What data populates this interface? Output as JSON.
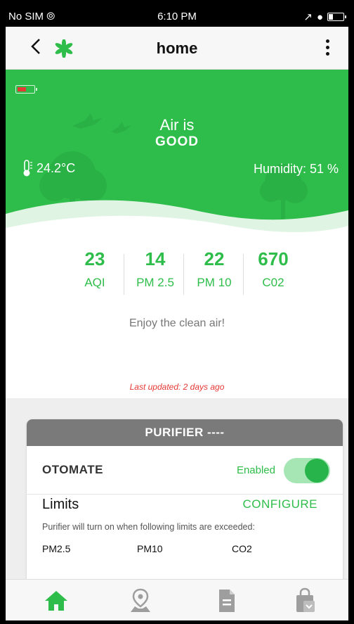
{
  "status_bar": {
    "carrier": "No SIM",
    "time": "6:10 PM"
  },
  "app_bar": {
    "title": "home"
  },
  "hero": {
    "air_line1": "Air is",
    "air_status": "GOOD",
    "temperature": "24.2°C",
    "humidity": "Humidity: 51 %",
    "device_battery_level": 0.4,
    "colors": {
      "green": "#2ebd4a",
      "battery_low": "#e53935"
    }
  },
  "stats": [
    {
      "value": "23",
      "label": "AQI"
    },
    {
      "value": "14",
      "label": "PM 2.5"
    },
    {
      "value": "22",
      "label": "PM 10"
    },
    {
      "value": "670",
      "label": "C02"
    }
  ],
  "message": "Enjoy the clean air!",
  "last_updated": "Last updated: 2 days ago",
  "purifier_card": {
    "header": "PURIFIER ----",
    "otomate_label": "OTOMATE",
    "enabled_label": "Enabled",
    "enabled": true,
    "limits_title": "Limits",
    "configure_label": "CONFIGURE",
    "limits_description": "Purifier will turn on when following limits are exceeded:",
    "limit_columns": [
      "PM2.5",
      "PM10",
      "CO2"
    ]
  },
  "bottom_nav": [
    {
      "icon": "home-icon",
      "active": true
    },
    {
      "icon": "map-pin-icon",
      "active": false
    },
    {
      "icon": "document-icon",
      "active": false
    },
    {
      "icon": "shopping-bag-icon",
      "active": false
    }
  ]
}
